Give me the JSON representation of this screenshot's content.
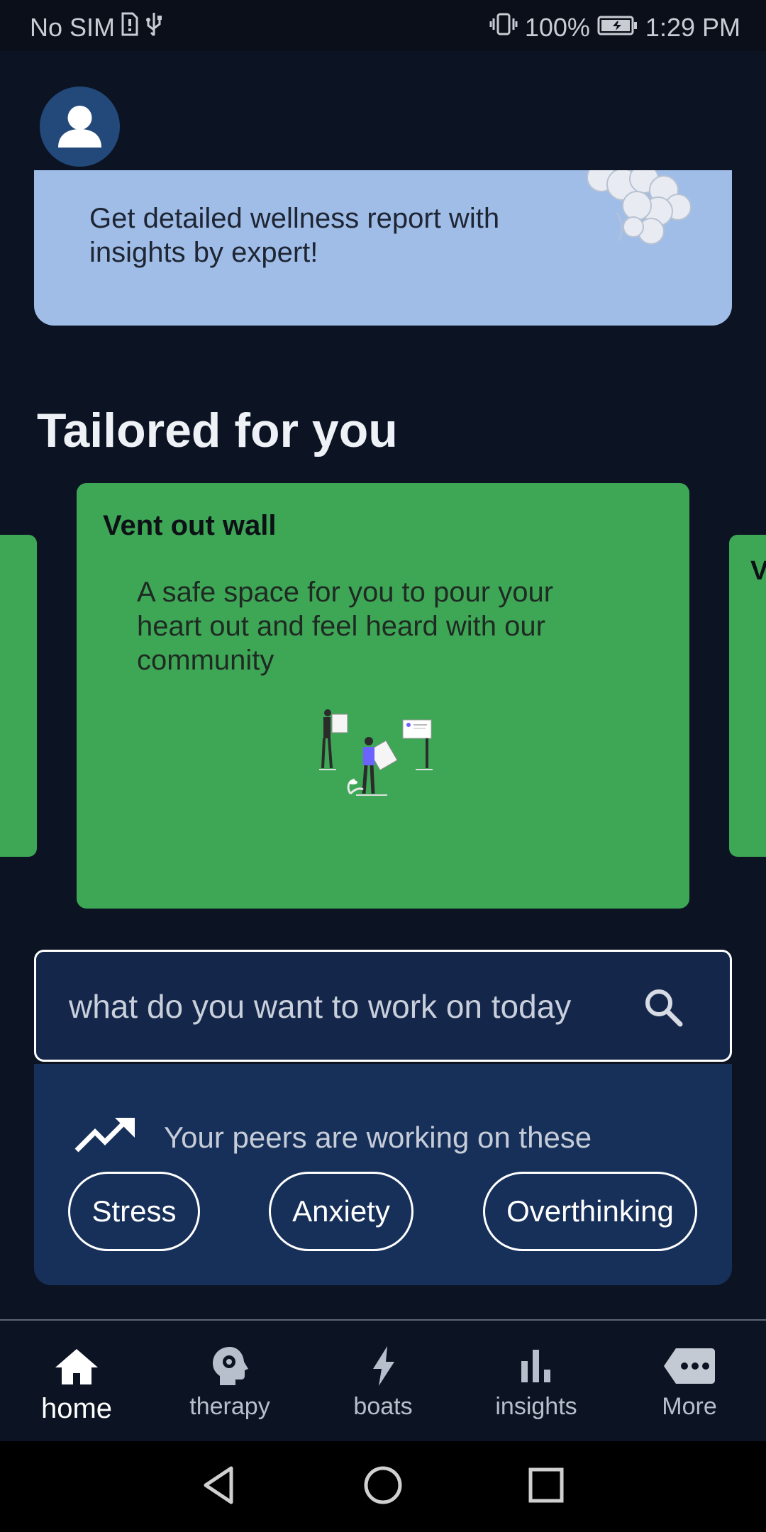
{
  "status_bar": {
    "carrier": "No SIM",
    "battery": "100%",
    "time": "1:29 PM"
  },
  "header": {
    "avatar_icon": "user-icon"
  },
  "wellness_banner": {
    "text": "Get detailed wellness report with insights by expert!"
  },
  "section": {
    "title": "Tailored for you"
  },
  "carousel": {
    "active_card": {
      "title": "Vent out wall",
      "description": "A safe space for you to pour your heart out and feel heard with our community"
    },
    "right_peek_letter": "V"
  },
  "search": {
    "placeholder": "what do you want to work on today"
  },
  "peers": {
    "heading": "Your peers are working on these",
    "chips": [
      "Stress",
      "Anxiety",
      "Overthinking"
    ]
  },
  "bottom_nav": {
    "items": [
      {
        "label": "home",
        "icon": "home-icon",
        "active": true
      },
      {
        "label": "therapy",
        "icon": "head-gear-icon",
        "active": false
      },
      {
        "label": "boats",
        "icon": "lightning-icon",
        "active": false
      },
      {
        "label": "insights",
        "icon": "bar-chart-icon",
        "active": false
      },
      {
        "label": "More",
        "icon": "more-icon",
        "active": false
      }
    ]
  },
  "colors": {
    "background": "#0c1424",
    "card_green": "#3ea756",
    "banner_blue": "#a0bde8",
    "panel_navy": "#17305a"
  }
}
